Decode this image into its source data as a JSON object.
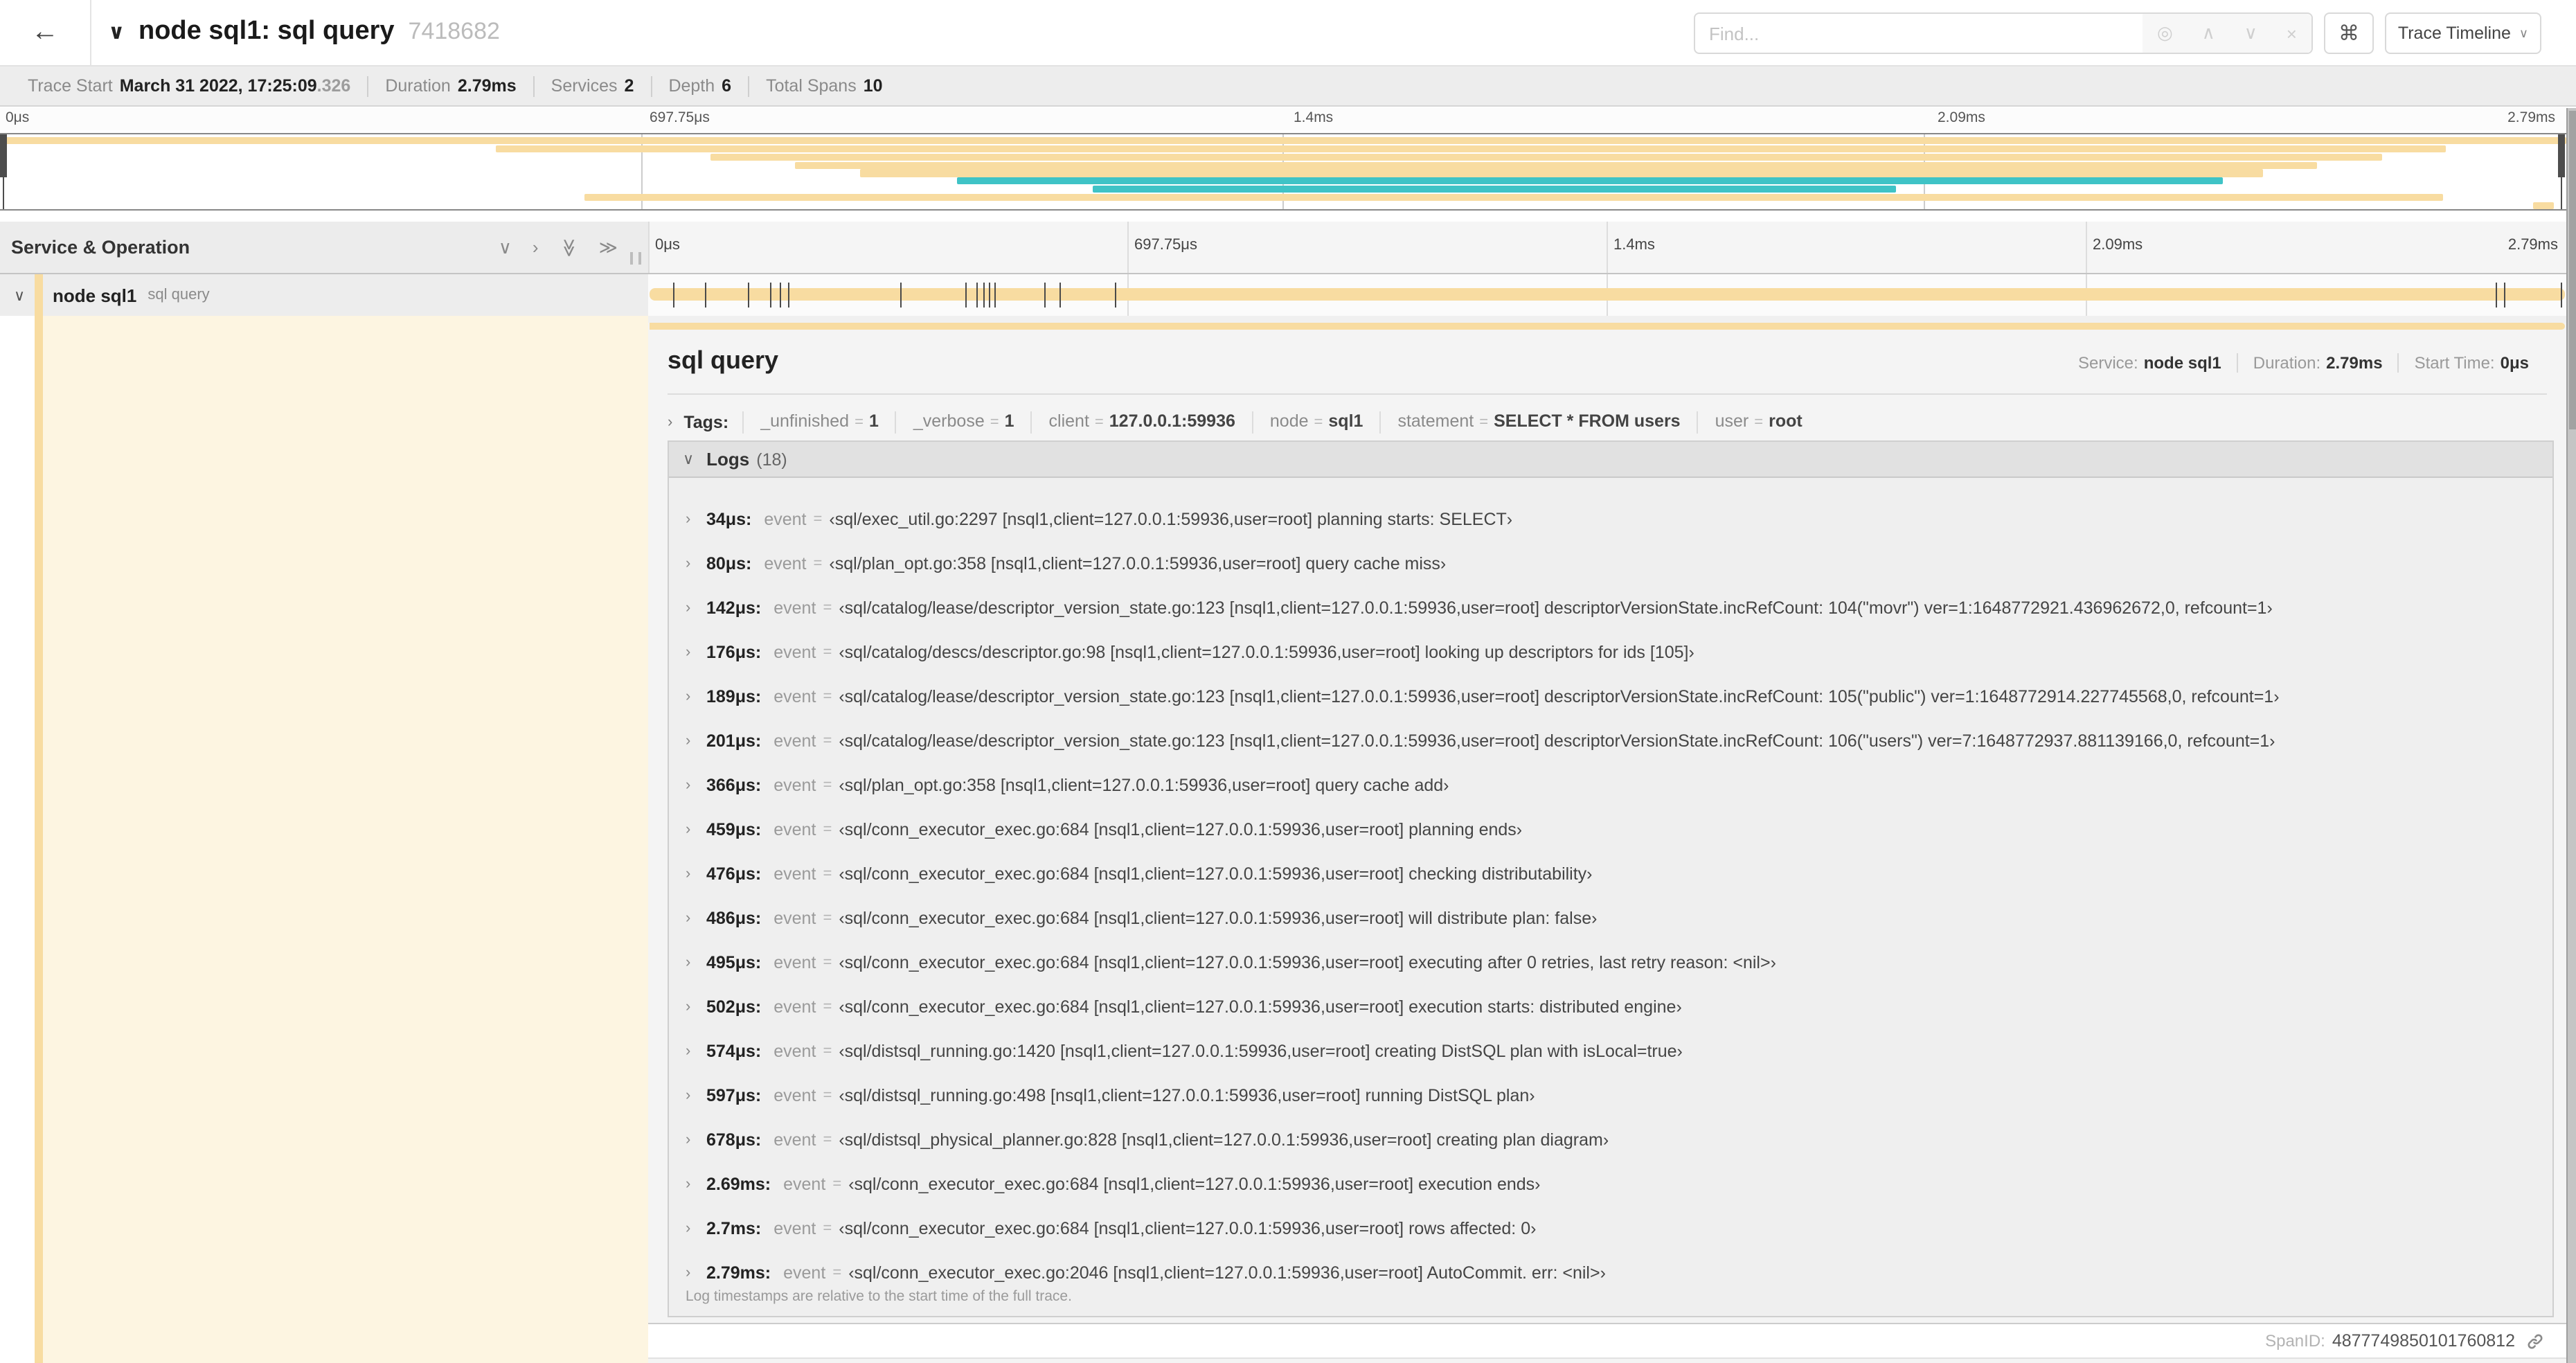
{
  "colors": {
    "tan": "#F8DCA1",
    "teal": "#3FC3C6",
    "cream": "#FDF5E1"
  },
  "icons": {
    "back": "←",
    "chevron_down": "∨",
    "chevron_right": "›",
    "double_chevron": "≫",
    "locate": "◎",
    "up": "∧",
    "down": "∨",
    "clear": "×",
    "command": "⌘"
  },
  "glyphs": {
    "eq": "="
  },
  "header": {
    "title": "node sql1: sql query",
    "trace_id": "7418682",
    "find_placeholder": "Find...",
    "shortcut_label": "⌘",
    "view_button_label": "Trace Timeline"
  },
  "trace_info": {
    "items": [
      {
        "label": "Trace Start",
        "value": "March 31 2022, 17:25:09",
        "suffix": ".326"
      },
      {
        "label": "Duration",
        "value": "2.79ms"
      },
      {
        "label": "Services",
        "value": "2"
      },
      {
        "label": "Depth",
        "value": "6"
      },
      {
        "label": "Total Spans",
        "value": "10"
      }
    ]
  },
  "timeline": {
    "ticks": [
      "0μs",
      "697.75μs",
      "1.4ms",
      "2.09ms",
      "2.79ms"
    ],
    "minimap_rows": [
      {
        "start": 0,
        "end": 100,
        "color": "tan"
      },
      {
        "start": 19.3,
        "end": 95.3,
        "color": "tan"
      },
      {
        "start": 27.7,
        "end": 92.8,
        "color": "tan"
      },
      {
        "start": 31.0,
        "end": 90.3,
        "color": "tan"
      },
      {
        "start": 33.5,
        "end": 88.2,
        "color": "tan"
      },
      {
        "start": 37.3,
        "end": 86.6,
        "color": "teal"
      },
      {
        "start": 42.6,
        "end": 73.9,
        "color": "teal"
      },
      {
        "start": 22.8,
        "end": 95.2,
        "color": "tan"
      },
      {
        "start": 98.7,
        "end": 99.5,
        "color": "tan"
      }
    ]
  },
  "grid": {
    "left_header": "Service & Operation"
  },
  "span_row": {
    "service": "node sql1",
    "operation": "sql query",
    "log_marks_pct": [
      1.2,
      2.9,
      5.1,
      6.3,
      6.8,
      7.2,
      13.1,
      16.5,
      17.1,
      17.4,
      17.7,
      18.0,
      20.6,
      21.4,
      24.3,
      96.4,
      96.8,
      99.8
    ]
  },
  "detail": {
    "title": "sql query",
    "meta": [
      {
        "label": "Service:",
        "value": "node sql1"
      },
      {
        "label": "Duration:",
        "value": "2.79ms"
      },
      {
        "label": "Start Time:",
        "value": "0μs"
      }
    ],
    "tags": {
      "label": "Tags:",
      "items": [
        {
          "key": "_unfinished",
          "value": "1"
        },
        {
          "key": "_verbose",
          "value": "1"
        },
        {
          "key": "client",
          "value": "127.0.0.1:59936"
        },
        {
          "key": "node",
          "value": "sql1"
        },
        {
          "key": "statement",
          "value": "SELECT * FROM users"
        },
        {
          "key": "user",
          "value": "root"
        }
      ]
    },
    "logs": {
      "label": "Logs",
      "count": "(18)",
      "entries": [
        {
          "time": "34μs:",
          "key": "event",
          "value": "‹sql/exec_util.go:2297 [nsql1,client=127.0.0.1:59936,user=root] planning starts: SELECT›"
        },
        {
          "time": "80μs:",
          "key": "event",
          "value": "‹sql/plan_opt.go:358 [nsql1,client=127.0.0.1:59936,user=root] query cache miss›"
        },
        {
          "time": "142μs:",
          "key": "event",
          "value": "‹sql/catalog/lease/descriptor_version_state.go:123 [nsql1,client=127.0.0.1:59936,user=root] descriptorVersionState.incRefCount: 104(\"movr\") ver=1:1648772921.436962672,0, refcount=1›"
        },
        {
          "time": "176μs:",
          "key": "event",
          "value": "‹sql/catalog/descs/descriptor.go:98 [nsql1,client=127.0.0.1:59936,user=root] looking up descriptors for ids [105]›"
        },
        {
          "time": "189μs:",
          "key": "event",
          "value": "‹sql/catalog/lease/descriptor_version_state.go:123 [nsql1,client=127.0.0.1:59936,user=root] descriptorVersionState.incRefCount: 105(\"public\") ver=1:1648772914.227745568,0, refcount=1›"
        },
        {
          "time": "201μs:",
          "key": "event",
          "value": "‹sql/catalog/lease/descriptor_version_state.go:123 [nsql1,client=127.0.0.1:59936,user=root] descriptorVersionState.incRefCount: 106(\"users\") ver=7:1648772937.881139166,0, refcount=1›"
        },
        {
          "time": "366μs:",
          "key": "event",
          "value": "‹sql/plan_opt.go:358 [nsql1,client=127.0.0.1:59936,user=root] query cache add›"
        },
        {
          "time": "459μs:",
          "key": "event",
          "value": "‹sql/conn_executor_exec.go:684 [nsql1,client=127.0.0.1:59936,user=root] planning ends›"
        },
        {
          "time": "476μs:",
          "key": "event",
          "value": "‹sql/conn_executor_exec.go:684 [nsql1,client=127.0.0.1:59936,user=root] checking distributability›"
        },
        {
          "time": "486μs:",
          "key": "event",
          "value": "‹sql/conn_executor_exec.go:684 [nsql1,client=127.0.0.1:59936,user=root] will distribute plan: false›"
        },
        {
          "time": "495μs:",
          "key": "event",
          "value": "‹sql/conn_executor_exec.go:684 [nsql1,client=127.0.0.1:59936,user=root] executing after 0 retries, last retry reason: <nil>›"
        },
        {
          "time": "502μs:",
          "key": "event",
          "value": "‹sql/conn_executor_exec.go:684 [nsql1,client=127.0.0.1:59936,user=root] execution starts: distributed engine›"
        },
        {
          "time": "574μs:",
          "key": "event",
          "value": "‹sql/distsql_running.go:1420 [nsql1,client=127.0.0.1:59936,user=root] creating DistSQL plan with isLocal=true›"
        },
        {
          "time": "597μs:",
          "key": "event",
          "value": "‹sql/distsql_running.go:498 [nsql1,client=127.0.0.1:59936,user=root] running DistSQL plan›"
        },
        {
          "time": "678μs:",
          "key": "event",
          "value": "‹sql/distsql_physical_planner.go:828 [nsql1,client=127.0.0.1:59936,user=root] creating plan diagram›"
        },
        {
          "time": "2.69ms:",
          "key": "event",
          "value": "‹sql/conn_executor_exec.go:684 [nsql1,client=127.0.0.1:59936,user=root] execution ends›"
        },
        {
          "time": "2.7ms:",
          "key": "event",
          "value": "‹sql/conn_executor_exec.go:684 [nsql1,client=127.0.0.1:59936,user=root] rows affected: 0›"
        },
        {
          "time": "2.79ms:",
          "key": "event",
          "value": "‹sql/conn_executor_exec.go:2046 [nsql1,client=127.0.0.1:59936,user=root] AutoCommit. err: <nil>›"
        }
      ],
      "footnote": "Log timestamps are relative to the start time of the full trace."
    },
    "span_id": {
      "label": "SpanID:",
      "value": "4877749850101760812"
    }
  }
}
